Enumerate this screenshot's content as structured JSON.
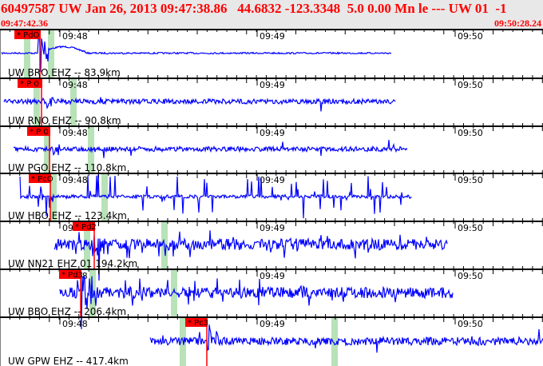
{
  "header": {
    "title": "60497587 UW Jan 26, 2013 09:47:38.86   44.6832 -123.3348  5.0 0.00 Mn le --- UW 01  -1",
    "start_time": "09:47:42.36",
    "end_time": "09:50:28.24"
  },
  "colors": {
    "pick": "#ff0000",
    "trace": "#0000ff",
    "band": "#b8e2b8",
    "header_bg": "#e8e8e8",
    "header_text": "#ff0000"
  },
  "minute_labels": [
    "09:48",
    "09:49",
    "09:50"
  ],
  "channels": [
    {
      "label": "UW BRO EHZ -- 83.9km",
      "pick": "* PdO",
      "style": "bump"
    },
    {
      "label": "UW RNO EHZ -- 90.8km",
      "pick": "* P 0",
      "style": "quiet"
    },
    {
      "label": "UW PGO EHZ -- 110.8km",
      "pick": "* P 0",
      "style": "quiet"
    },
    {
      "label": "UW HBO EHZ -- 123.4km",
      "pick": "* PcO",
      "style": "spiky"
    },
    {
      "label": "UW NN21 EHZ 01 194.2km",
      "pick": "* Pd2",
      "style": "noisy"
    },
    {
      "label": "UW BBO EHZ -- 206.4km",
      "pick": "* Pd3",
      "style": "noisy"
    },
    {
      "label": "UW GPW EHZ -- 417.4km",
      "pick": "* Pc3",
      "style": "quiet2"
    }
  ]
}
